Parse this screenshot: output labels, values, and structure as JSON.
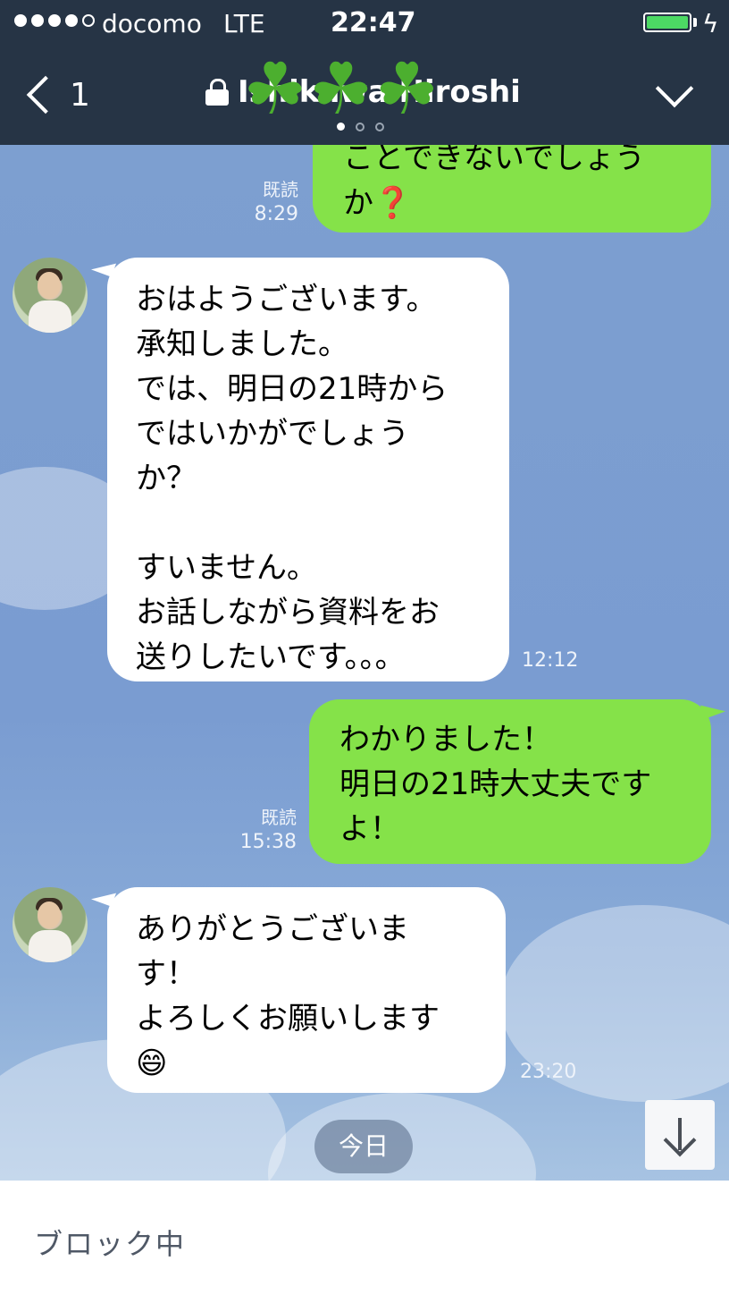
{
  "status_bar": {
    "carrier": "docomo",
    "network": "LTE",
    "time": "22:47",
    "signal_bars_filled": 4,
    "signal_bars_total": 5,
    "battery_level": 1.0
  },
  "header": {
    "back_count": "1",
    "title": "Ishikawa Hiroshi",
    "decoration": "☘☘☘",
    "page_indicator_count": 3,
    "page_indicator_active": 1
  },
  "messages": [
    {
      "id": "m1",
      "direction": "out",
      "text": "ことできないでしょう\nか❓",
      "read_label": "既読",
      "time": "8:29"
    },
    {
      "id": "m2",
      "direction": "in",
      "text": "おはようございます。\n承知しました。\nでは、明日の21時から\nではいかがでしょう\nか？\n\nすいません。\nお話しながら資料をお\n送りしたいです。。。",
      "time": "12:12"
    },
    {
      "id": "m3",
      "direction": "out",
      "text": "わかりました！\n明日の21時大丈夫です\nよ！",
      "read_label": "既読",
      "time": "15:38"
    },
    {
      "id": "m4",
      "direction": "in",
      "text": "ありがとうございま\nす！\nよろしくお願いします\n😄",
      "time": "23:20"
    }
  ],
  "date_separator": "今日",
  "footer": {
    "blocked_label": "ブロック中"
  },
  "colors": {
    "header_bg": "#263445",
    "outgoing_bubble": "#85e249",
    "incoming_bubble": "#ffffff",
    "battery": "#4cd964"
  },
  "icons": [
    "back-chevron-icon",
    "lock-icon",
    "clover-icon",
    "collapse-chevron-icon",
    "arrow-down-icon",
    "lightning-icon"
  ]
}
